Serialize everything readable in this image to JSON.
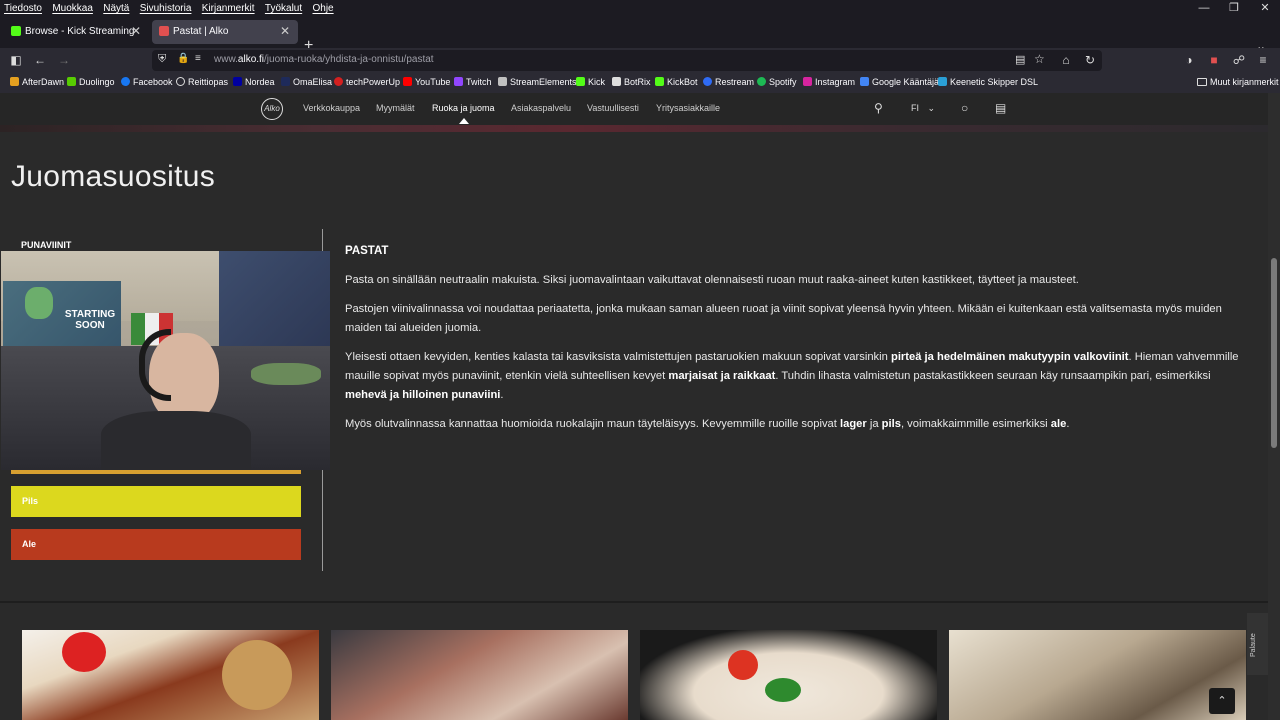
{
  "browser": {
    "menu": [
      "Tiedosto",
      "Muokkaa",
      "Näytä",
      "Sivuhistoria",
      "Kirjanmerkit",
      "Työkalut",
      "Ohje"
    ],
    "tabs": [
      {
        "title": "Browse - Kick Streaming"
      },
      {
        "title": "Pastat | Alko",
        "active": true
      }
    ],
    "url": {
      "prefix": "www.",
      "domain": "alko.fi",
      "path": "/juoma-ruoka/yhdista-ja-onnistu/pastat"
    },
    "bookmarks": [
      "AfterDawn",
      "Duolingo",
      "Facebook",
      "Reittiopas",
      "Nordea",
      "OmaElisa",
      "techPowerUp",
      "YouTube",
      "Twitch",
      "StreamElements",
      "Kick",
      "BotRix",
      "KickBot",
      "Restream",
      "Spotify",
      "Instagram",
      "Google Kääntäjä",
      "Keenetic Skipper DSL"
    ],
    "other_bookmarks": "Muut kirjanmerkit"
  },
  "site": {
    "logo": "Alko",
    "nav": [
      "Verkkokauppa",
      "Myymälät",
      "Ruoka ja juoma",
      "Asiakaspalvelu",
      "Vastuullisesti",
      "Yritysasiakkaille"
    ],
    "active_nav": "Ruoka ja juoma",
    "language": "FI"
  },
  "page": {
    "title": "Juomasuositus",
    "category": "PUNAVIINIT",
    "buttons": [
      "Pils",
      "Ale"
    ],
    "webcam_overlay_text": "STARTING SOON",
    "article": {
      "heading": "PASTAT",
      "p1": "Pasta on sinällään neutraalin makuista. Siksi juomavalintaan vaikuttavat olennaisesti ruoan muut raaka-aineet kuten kastikkeet, täytteet ja mausteet.",
      "p2": "Pastojen viinivalinnassa voi noudattaa periaatetta, jonka mukaan saman alueen ruoat ja viinit sopivat yleensä hyvin yhteen. Mikään ei kuitenkaan estä valitsemasta myös muiden maiden tai alueiden juomia.",
      "p3_a": "Yleisesti ottaen kevyiden, kenties kalasta tai kasviksista valmistettujen pastaruokien makuun sopivat varsinkin ",
      "p3_b": "pirteä ja hedelmäinen makutyypin valkoviinit",
      "p3_c": ". Hieman vahvemmille mauille sopivat myös punaviinit, etenkin vielä suhteellisen kevyet ",
      "p3_d": "marjaisat ja raikkaat",
      "p3_e": ". Tuhdin lihasta valmistetun pastakastikkeen seuraan käy runsaampikin pari, esimerkiksi ",
      "p3_f": "mehevä ja hilloinen punaviini",
      "p3_g": ".",
      "p4_a": "Myös olutvalinnassa kannattaa huomioida ruokalajin maun täyteläisyys. Kevyemmille ruoille sopivat ",
      "p4_b": "lager",
      "p4_c": " ja ",
      "p4_d": "pils",
      "p4_e": ", voimakkaimmille esimerkiksi ",
      "p4_f": "ale",
      "p4_g": "."
    }
  },
  "feedback_label": "Palaute",
  "colors": {
    "pils": "#dcd81e",
    "ale": "#b83a1e",
    "accent": "#d8a030"
  }
}
